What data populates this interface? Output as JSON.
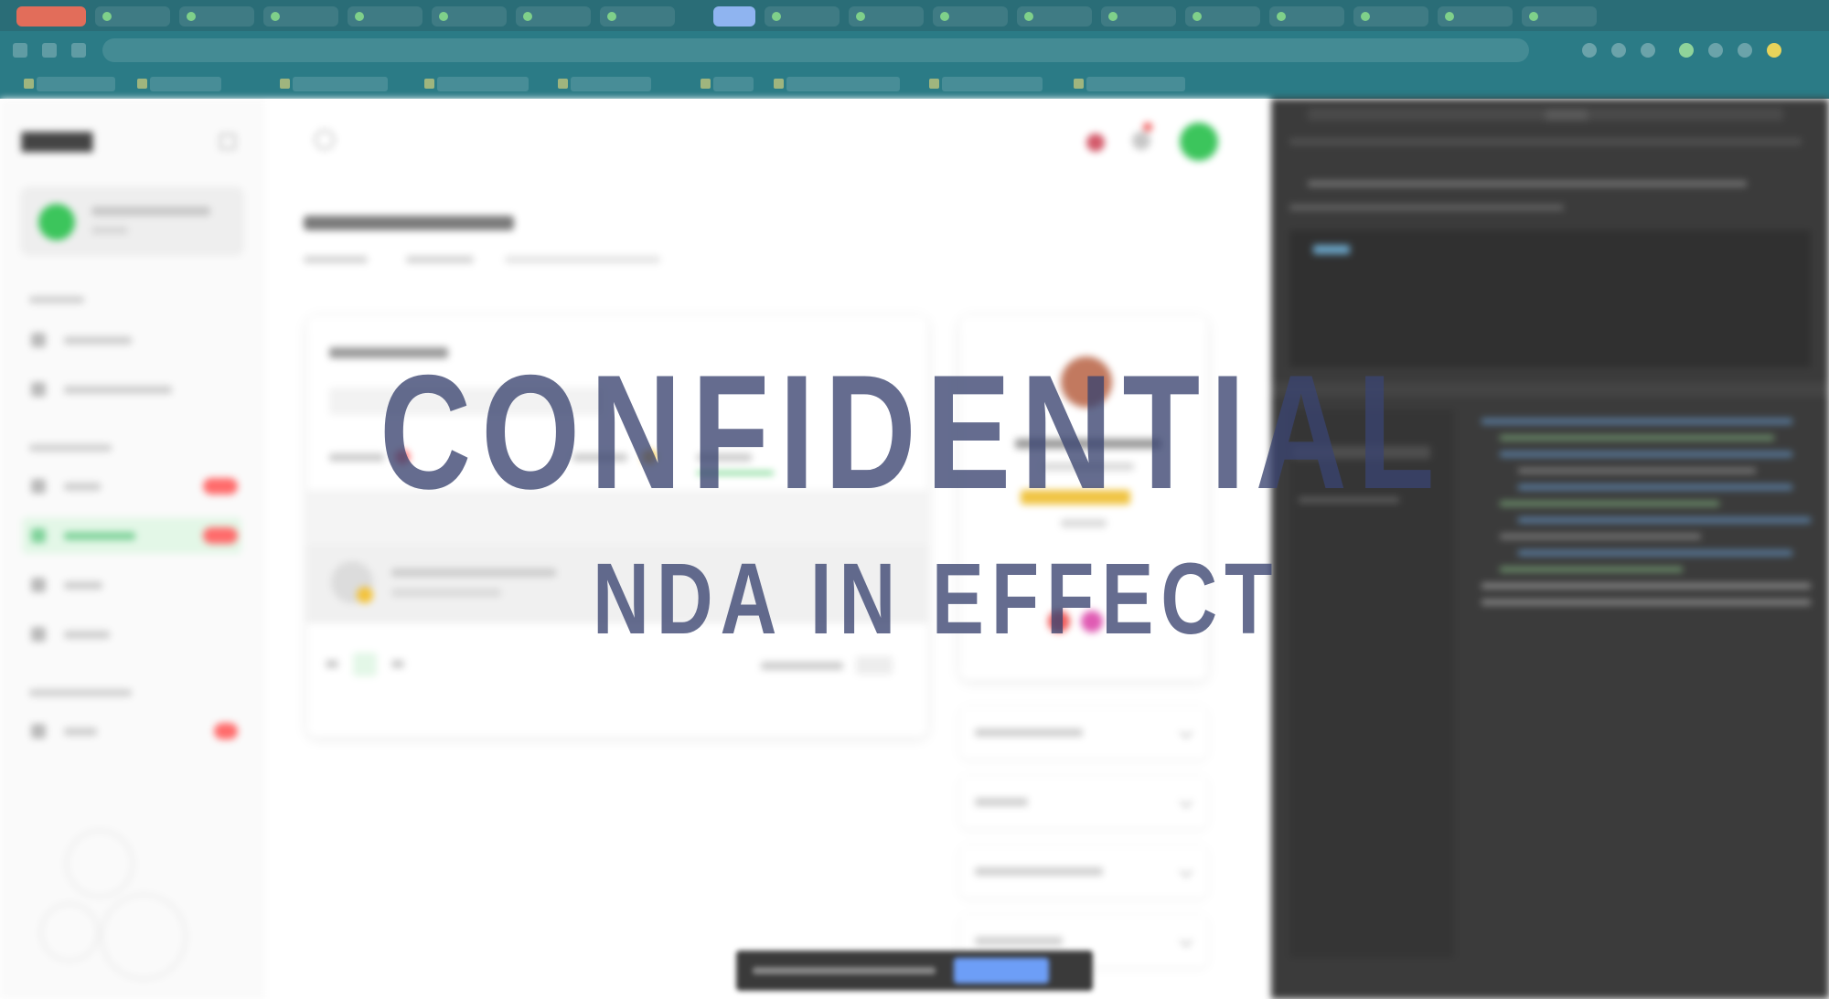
{
  "watermark": {
    "primary": "CONFIDENTIAL",
    "secondary": "NDA IN EFFECT"
  },
  "colors": {
    "browser_chrome": "#2b7b86",
    "brand_green": "#3cc55c",
    "badge_red": "#ff6b6b",
    "devtools_bg": "#3b3b3b",
    "watermark": "#3a4470"
  }
}
